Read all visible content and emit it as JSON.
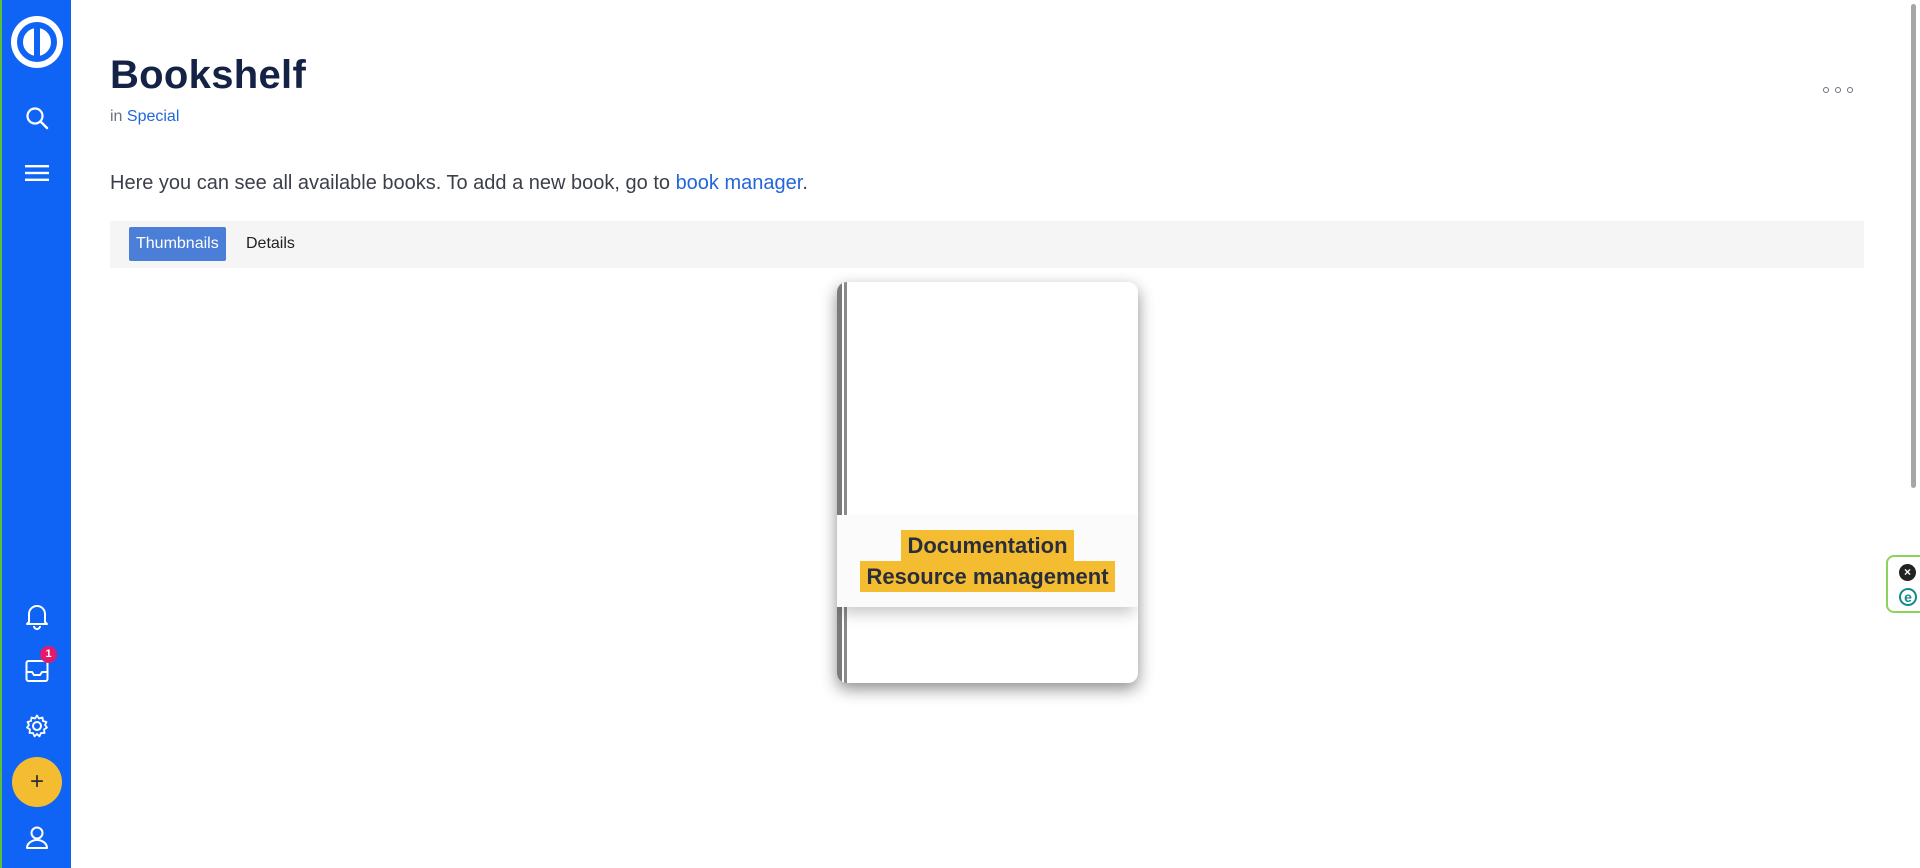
{
  "sidebar": {
    "logo": "logo-icon",
    "items": [
      {
        "name": "search",
        "icon": "search-icon"
      },
      {
        "name": "menu",
        "icon": "hamburger-icon"
      },
      {
        "name": "notifications",
        "icon": "bell-icon"
      },
      {
        "name": "inbox",
        "icon": "inbox-icon",
        "badge": "1"
      },
      {
        "name": "settings",
        "icon": "gear-icon"
      },
      {
        "name": "add",
        "icon": "plus-icon",
        "label": "+"
      },
      {
        "name": "user",
        "icon": "user-icon"
      }
    ],
    "background": "#0f64f5",
    "add_color": "#f4bc31"
  },
  "header": {
    "title": "Bookshelf",
    "breadcrumb_prefix": "in",
    "breadcrumb_link": "Special",
    "more_icon": "more-dots-icon"
  },
  "intro": {
    "text": "Here you can see all available books. To add a new book, go to",
    "link": "book manager",
    "suffix": "."
  },
  "tabs": [
    {
      "label": "Thumbnails",
      "active": true
    },
    {
      "label": "Details",
      "active": false
    }
  ],
  "books": [
    {
      "title_line1": "Documentation",
      "title_line2": "Resource management"
    }
  ],
  "widget": {
    "close_label": "×",
    "e_label": "e"
  },
  "colors": {
    "accent": "#2266dd",
    "tab_active": "#4b7ed6",
    "book_label": "#f4bc31",
    "badge": "#e3196d"
  }
}
